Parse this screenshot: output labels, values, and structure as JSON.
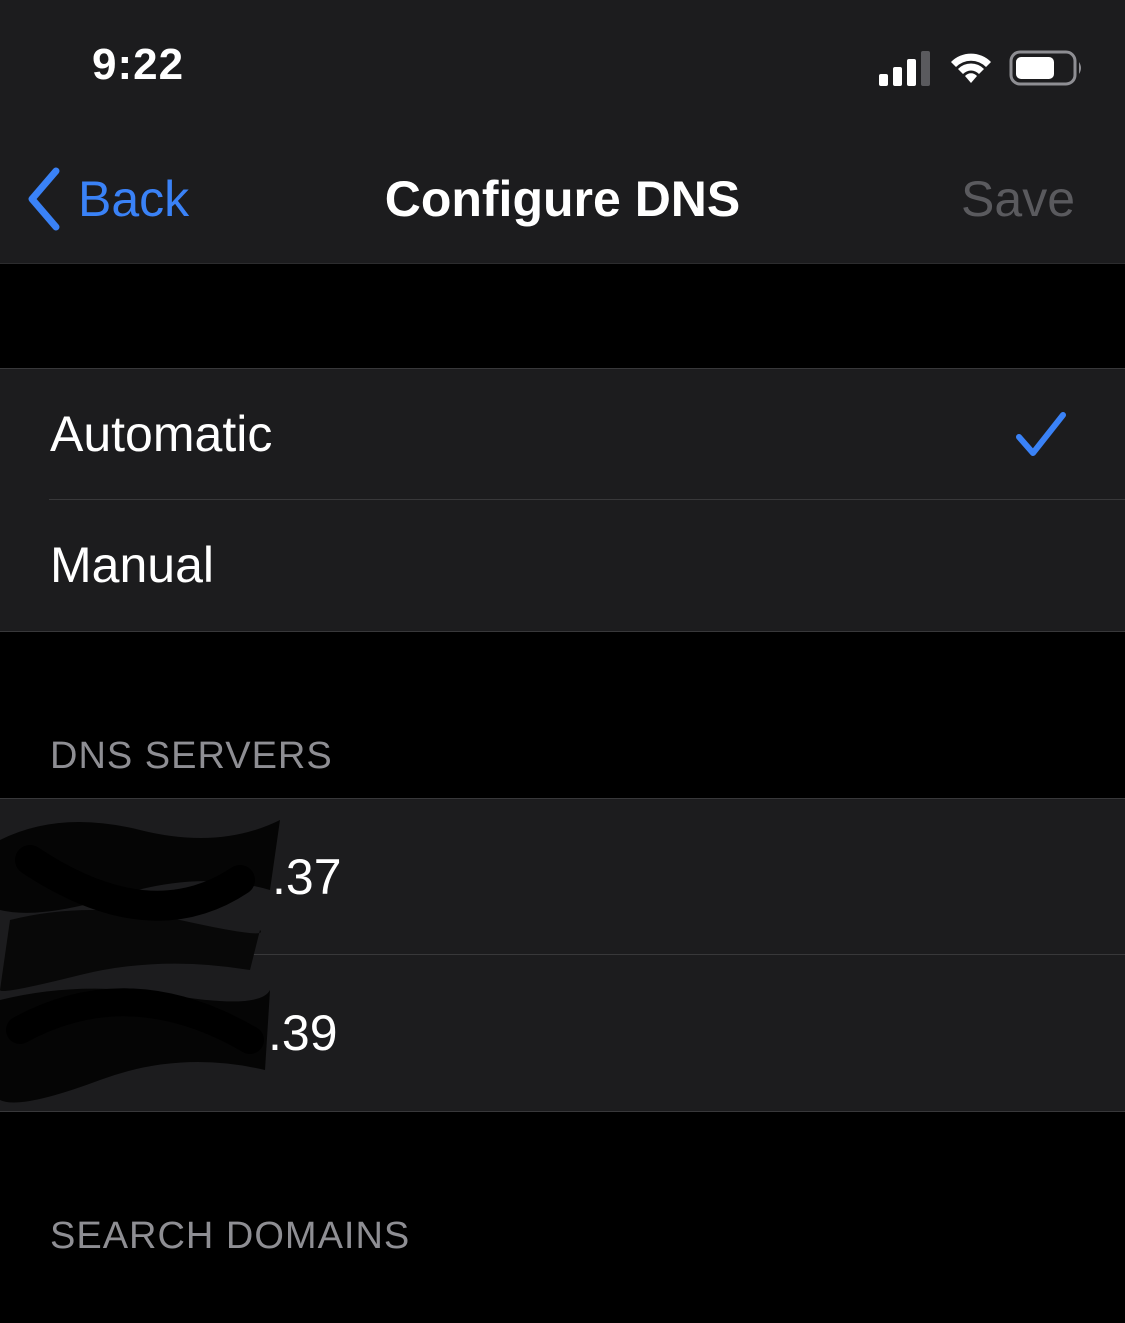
{
  "status_bar": {
    "time": "9:22",
    "icons": [
      "cellular-signal-icon",
      "wifi-icon",
      "battery-icon"
    ]
  },
  "nav": {
    "back_label": "Back",
    "title": "Configure DNS",
    "save_label": "Save"
  },
  "mode_options": [
    {
      "label": "Automatic",
      "selected": true
    },
    {
      "label": "Manual",
      "selected": false
    }
  ],
  "dns_servers": {
    "header": "DNS SERVERS",
    "entries": [
      ".37",
      ".39"
    ]
  },
  "search_domains": {
    "header": "SEARCH DOMAINS"
  },
  "colors": {
    "accent": "#3a82f7",
    "background": "#000000",
    "cell": "#1c1c1e",
    "separator": "#38383a",
    "secondary_text": "#8e8e93",
    "disabled_text": "#5a5a5e"
  }
}
